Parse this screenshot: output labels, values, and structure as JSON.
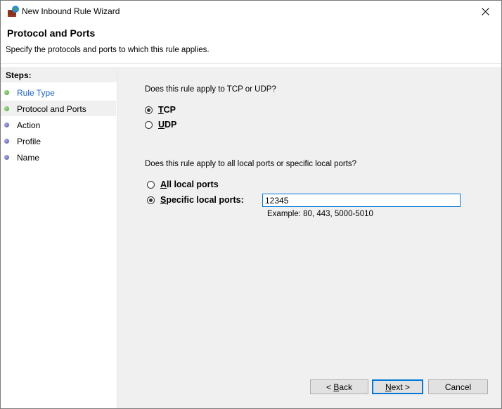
{
  "window": {
    "title": "New Inbound Rule Wizard",
    "icon": "firewall-icon",
    "close_icon": "close-icon"
  },
  "header": {
    "title": "Protocol and Ports",
    "subtitle": "Specify the protocols and ports to which this rule applies."
  },
  "sidebar": {
    "heading": "Steps:",
    "items": [
      {
        "label": "Rule Type",
        "state": "done",
        "link": true
      },
      {
        "label": "Protocol and Ports",
        "state": "done",
        "active": true
      },
      {
        "label": "Action",
        "state": "todo"
      },
      {
        "label": "Profile",
        "state": "todo"
      },
      {
        "label": "Name",
        "state": "todo"
      }
    ]
  },
  "main": {
    "protocol_question": "Does this rule apply to TCP or UDP?",
    "protocol_options": [
      {
        "accel": "T",
        "rest": "CP",
        "checked": true
      },
      {
        "accel": "U",
        "rest": "DP",
        "checked": false
      }
    ],
    "ports_question": "Does this rule apply to all local ports or specific local ports?",
    "ports_options": [
      {
        "accel": "A",
        "rest": "ll local ports",
        "checked": false
      },
      {
        "accel": "S",
        "rest": "pecific local ports:",
        "checked": true
      }
    ],
    "ports_value": "12345",
    "ports_example": "Example: 80, 443, 5000-5010"
  },
  "buttons": {
    "back": {
      "prefix": "< ",
      "accel": "B",
      "rest": "ack"
    },
    "next": {
      "accel": "N",
      "rest": "ext >"
    },
    "cancel": "Cancel"
  }
}
